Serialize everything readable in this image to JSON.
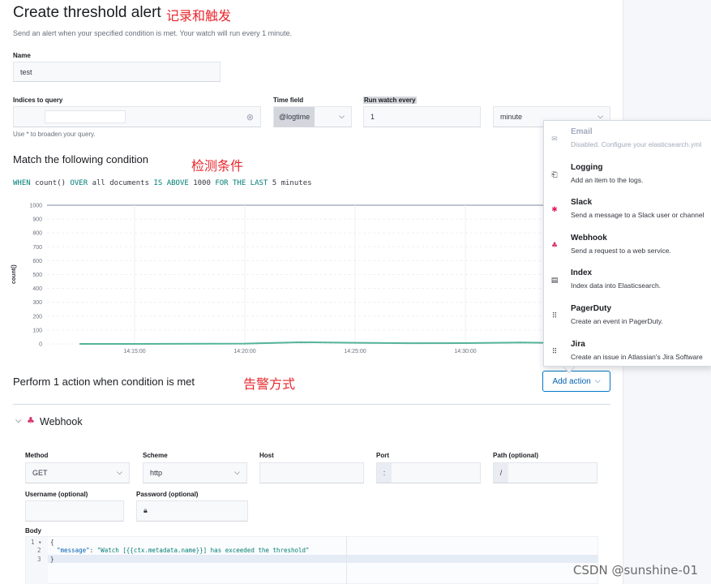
{
  "header": {
    "title": "Create threshold alert",
    "title_note": "记录和触发",
    "subtitle": "Send an alert when your specified condition is met. Your watch will run every 1 minute."
  },
  "name_field": {
    "label": "Name",
    "value": "test"
  },
  "indices": {
    "label": "Indices to query",
    "value": "",
    "help": "Use * to broaden your query."
  },
  "time_field": {
    "label": "Time field",
    "value": "@logtime"
  },
  "run_every": {
    "label": "Run watch every",
    "value": "1",
    "unit": "minute"
  },
  "condition": {
    "heading": "Match the following condition",
    "note": "检测条件",
    "expression": [
      {
        "text": "WHEN",
        "kw": true
      },
      {
        "text": " count() ",
        "kw": false
      },
      {
        "text": "OVER",
        "kw": true
      },
      {
        "text": " all documents ",
        "kw": false
      },
      {
        "text": "IS ABOVE",
        "kw": true
      },
      {
        "text": " 1000 ",
        "kw": false
      },
      {
        "text": "FOR THE LAST",
        "kw": true
      },
      {
        "text": " 5 minutes",
        "kw": false
      }
    ]
  },
  "chart_data": {
    "type": "line",
    "ylabel": "count()",
    "ylim": [
      0,
      1000
    ],
    "yticks": [
      1000,
      900,
      800,
      700,
      600,
      500,
      400,
      300,
      200,
      100,
      0
    ],
    "xticks": [
      "14:15:00",
      "14:20:00",
      "14:25:00",
      "14:30:00"
    ],
    "threshold": 1000,
    "series": [
      {
        "color": "#54b399",
        "x": [
          -1,
          0,
          1,
          1.5,
          2,
          2.5,
          3,
          3.5,
          4,
          4.4
        ],
        "y": [
          0,
          0,
          2,
          12,
          8,
          5,
          6,
          10,
          8,
          8
        ]
      }
    ],
    "line_color": "#54b399",
    "threshold_color": "#98a2b3"
  },
  "actions": {
    "heading": "Perform 1 action when condition is met",
    "note": "告警方式",
    "add_label": "Add action"
  },
  "popover": {
    "items": [
      {
        "icon": "email-icon",
        "glyph": "✉",
        "title": "Email",
        "desc": "Disabled. Configure your elasticsearch.yml",
        "disabled": true
      },
      {
        "icon": "logging-icon",
        "glyph": "⎗",
        "title": "Logging",
        "desc": "Add an item to the logs.",
        "disabled": false
      },
      {
        "icon": "slack-icon",
        "glyph": "✱",
        "title": "Slack",
        "desc": "Send a message to a Slack user or channel",
        "disabled": false
      },
      {
        "icon": "webhook-icon",
        "glyph": "♣",
        "title": "Webhook",
        "desc": "Send a request to a web service.",
        "disabled": false
      },
      {
        "icon": "index-icon",
        "glyph": "▤",
        "title": "Index",
        "desc": "Index data into Elasticsearch.",
        "disabled": false
      },
      {
        "icon": "pagerduty-icon",
        "glyph": "⠿",
        "title": "PagerDuty",
        "desc": "Create an event in PagerDuty.",
        "disabled": false
      },
      {
        "icon": "jira-icon",
        "glyph": "⠿",
        "title": "Jira",
        "desc": "Create an issue in Atlassian's Jira Software",
        "disabled": false
      }
    ]
  },
  "webhook": {
    "title": "Webhook",
    "method": {
      "label": "Method",
      "value": "GET"
    },
    "scheme": {
      "label": "Scheme",
      "value": "http"
    },
    "host": {
      "label": "Host",
      "value": ""
    },
    "port": {
      "label": "Port",
      "prefix": ":"
    },
    "path": {
      "label": "Path (optional)",
      "prefix": "/"
    },
    "username": {
      "label": "Username (optional)",
      "value": ""
    },
    "password": {
      "label": "Password (optional)",
      "value": ""
    },
    "body": {
      "label": "Body",
      "lines": [
        {
          "num": "1",
          "text": "{"
        },
        {
          "num": "2",
          "key": "\"message\"",
          "val": "\"Watch [{{ctx.metadata.name}}] has exceeded the threshold\""
        },
        {
          "num": "3",
          "text": "}"
        }
      ]
    }
  },
  "watermark": "CSDN @sunshine-01"
}
